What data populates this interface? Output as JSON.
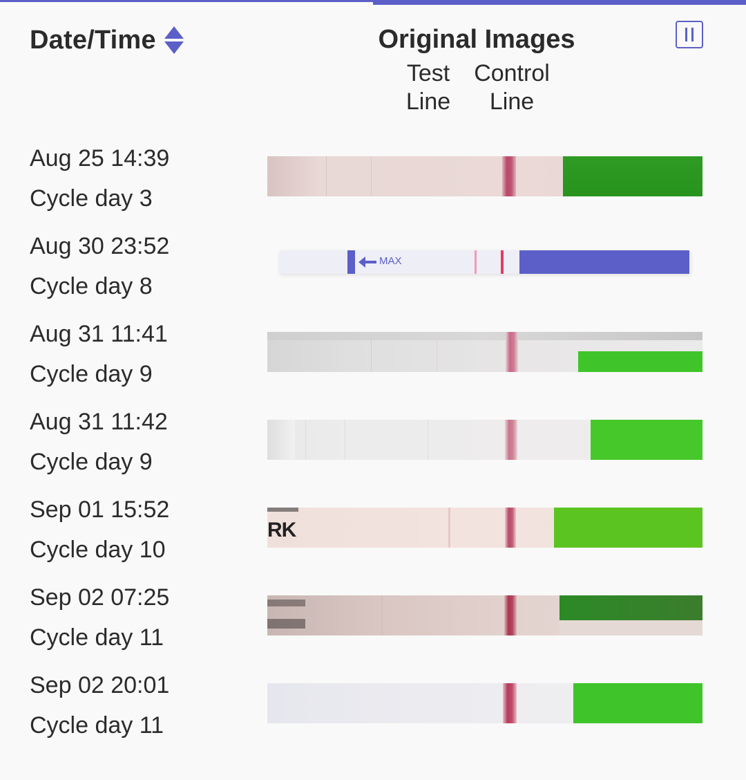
{
  "header": {
    "date_label": "Date/Time",
    "images_label": "Original Images",
    "test_line_label": "Test\nLine",
    "control_line_label": "Control\nLine",
    "sort_icon": "sort-up-down-icon",
    "pause_icon": "pause-icon"
  },
  "colors": {
    "accent": "#5b5fc7",
    "background": "#f9f9f9",
    "text": "#2b2b2b",
    "strip_green": "#3fc52a",
    "control_line": "#b8304e"
  },
  "rows": [
    {
      "date": "Aug 25 14:39",
      "cycle": "Cycle day 3"
    },
    {
      "date": "Aug 30 23:52",
      "cycle": "Cycle day 8",
      "strip_label": "MAX"
    },
    {
      "date": "Aug 31 11:41",
      "cycle": "Cycle day 9"
    },
    {
      "date": "Aug 31 11:42",
      "cycle": "Cycle day 9"
    },
    {
      "date": "Sep 01 15:52",
      "cycle": "Cycle day 10",
      "strip_text": "RK"
    },
    {
      "date": "Sep 02 07:25",
      "cycle": "Cycle day 11"
    },
    {
      "date": "Sep 02 20:01",
      "cycle": "Cycle day 11"
    }
  ]
}
